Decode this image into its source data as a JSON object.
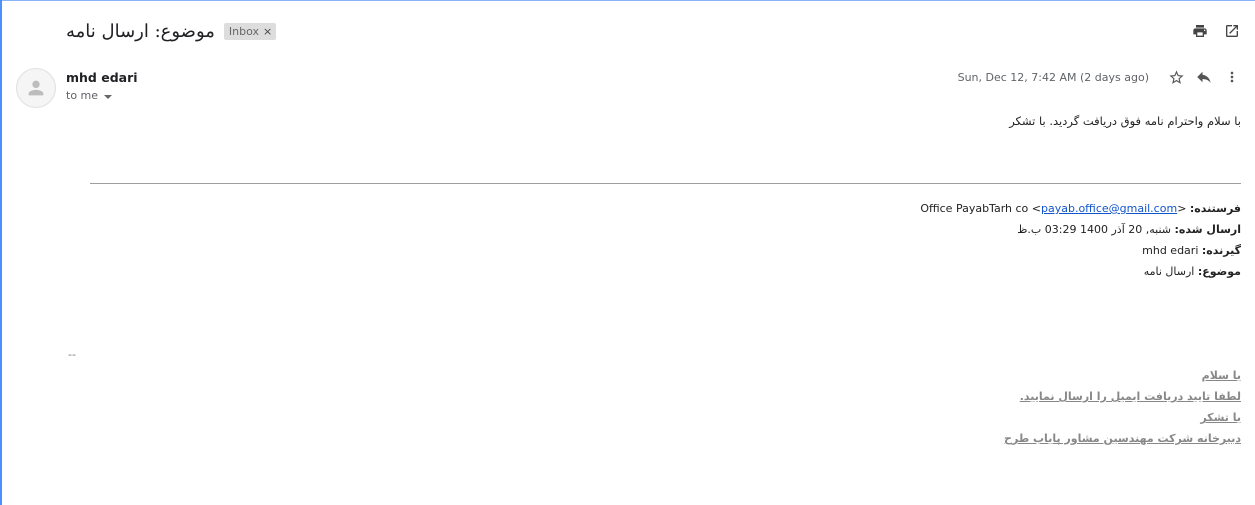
{
  "email": {
    "subject": "موضوع: ارسال نامه",
    "label": "Inbox",
    "label_remove": "×",
    "sender_name": "mhd edari",
    "recipient": "to me",
    "date": "Sun, Dec 12, 7:42 AM (2 days ago)",
    "body": "با سلام واحترام نامه فوق دریافت گردید. با تشکر"
  },
  "forwarded": {
    "from_label": "فرستنده:",
    "from_name": "Office PayabTarh co <",
    "from_email": "payab.office@gmail.com",
    "from_close": ">",
    "sent_label": "ارسال شده:",
    "sent_value": "شنبه, 20 آذر 1400 03:29 ب.ظ",
    "to_label": "گیرنده:",
    "to_value": "mhd edari",
    "subject_label": "موضوع:",
    "subject_value": "ارسال نامه"
  },
  "signature": {
    "separator": "--",
    "lines": [
      "با سلام",
      "لطفا تایید دریافت ایمیل را ارسال نمایید.",
      "با تشکر",
      "دبیرخانه شرکت مهندسین مشاور پایاب طرح"
    ]
  },
  "icons": {
    "print": "print-icon",
    "open_new_window": "open-in-new-window-icon",
    "star": "star-icon",
    "reply": "reply-icon",
    "more": "more-vert-icon",
    "avatar": "person-icon"
  }
}
